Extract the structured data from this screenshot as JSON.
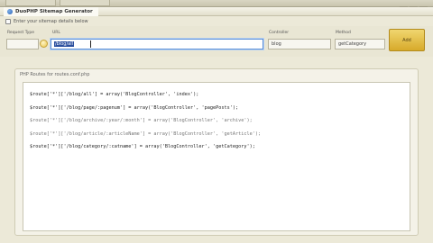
{
  "window": {
    "title": "DuoPHP Sitemap Generator",
    "controls": [
      "–",
      "□",
      "x"
    ]
  },
  "hint": "Enter your sitemap details below",
  "form": {
    "request_type_label": "Request Type",
    "request_type_value": "",
    "url_label": "URL",
    "url_value": "/blog/all",
    "controller_label": "Controller",
    "controller_value": "blog",
    "method_label": "Method",
    "method_value": "getCategory",
    "add_label": "Add"
  },
  "routes_panel": {
    "title": "PHP Routes for routes.conf.php",
    "lines": [
      "$route['*']['/blog/all'] = array('BlogController', 'index');",
      "$route['*']['/blog/page/:pagenum'] = array('BlogController', 'pagePosts');",
      "$route['*']['/blog/archive/:year/:month'] = array('BlogController', 'archive');",
      "$route['*']['/blog/article/:articleName'] = array('BlogController', 'getArticle');",
      "$route['*']['/blog/category/:catname'] = array('BlogController', 'getCategory');"
    ]
  },
  "colors": {
    "background": "#ece9d8",
    "accent_button": "#e3bf45",
    "focus_border": "#5b8fd6"
  }
}
